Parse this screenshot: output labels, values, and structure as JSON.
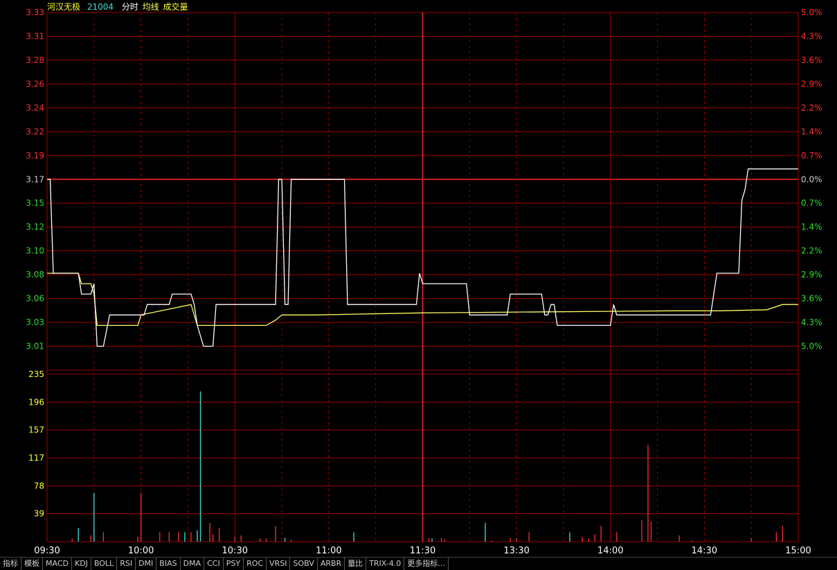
{
  "header": {
    "stock_name": "河汉无极",
    "stock_code": "21004",
    "label_fenshi": "分时",
    "label_junxian": "均线",
    "label_volume": "成交量"
  },
  "price_axis": {
    "labels": [
      "3.33",
      "3.31",
      "3.28",
      "3.26",
      "3.24",
      "3.22",
      "3.19",
      "3.17",
      "3.15",
      "3.12",
      "3.10",
      "3.08",
      "3.06",
      "3.03",
      "3.01"
    ],
    "label_colors": [
      "#ff3030",
      "#ff3030",
      "#ff3030",
      "#ff3030",
      "#ff3030",
      "#ff3030",
      "#ff3030",
      "#cccccc",
      "#33dd33",
      "#33dd33",
      "#33dd33",
      "#33dd33",
      "#33dd33",
      "#33dd33",
      "#33dd33"
    ]
  },
  "pct_axis": {
    "labels": [
      "5.0%",
      "4.3%",
      "3.6%",
      "2.9%",
      "2.2%",
      "1.4%",
      "0.7%",
      "0.0%",
      "0.7%",
      "1.4%",
      "2.2%",
      "2.9%",
      "3.6%",
      "4.3%",
      "5.0%"
    ],
    "label_colors": [
      "#ff3030",
      "#ff3030",
      "#ff3030",
      "#ff3030",
      "#ff3030",
      "#ff3030",
      "#ff3030",
      "#cccccc",
      "#33dd33",
      "#33dd33",
      "#33dd33",
      "#33dd33",
      "#33dd33",
      "#33dd33",
      "#33dd33"
    ]
  },
  "volume_axis": {
    "labels": [
      "235",
      "196",
      "157",
      "117",
      "78",
      "39"
    ]
  },
  "time_axis": {
    "labels": [
      "09:30",
      "10:00",
      "10:30",
      "11:00",
      "11:30",
      "13:30",
      "14:00",
      "14:30",
      "15:00"
    ]
  },
  "colors": {
    "grid": "#a00000",
    "price_line": "#ffffff",
    "avg_line": "#ffff66",
    "vol_up": "#ff3030",
    "vol_down": "#40e0e0",
    "volume_label": "#ffff33"
  },
  "chart_data": {
    "type": "line",
    "prev_close": 3.17,
    "x_range_minutes": [
      0,
      240
    ],
    "price": [
      [
        0,
        3.17
      ],
      [
        1,
        3.17
      ],
      [
        2,
        3.08
      ],
      [
        10,
        3.08
      ],
      [
        11,
        3.06
      ],
      [
        14,
        3.06
      ],
      [
        15,
        3.07
      ],
      [
        16,
        3.01
      ],
      [
        18,
        3.01
      ],
      [
        20,
        3.04
      ],
      [
        31,
        3.04
      ],
      [
        32,
        3.05
      ],
      [
        39,
        3.05
      ],
      [
        40,
        3.06
      ],
      [
        46,
        3.06
      ],
      [
        47,
        3.05
      ],
      [
        48,
        3.03
      ],
      [
        50,
        3.01
      ],
      [
        53,
        3.01
      ],
      [
        54,
        3.05
      ],
      [
        73,
        3.05
      ],
      [
        74,
        3.17
      ],
      [
        75,
        3.17
      ],
      [
        76,
        3.05
      ],
      [
        77,
        3.05
      ],
      [
        78,
        3.17
      ],
      [
        95,
        3.17
      ],
      [
        96,
        3.05
      ],
      [
        118,
        3.05
      ],
      [
        119,
        3.08
      ],
      [
        120,
        3.07
      ],
      [
        134,
        3.07
      ],
      [
        135,
        3.04
      ],
      [
        140,
        3.04
      ],
      [
        141,
        3.04
      ],
      [
        147,
        3.04
      ],
      [
        148,
        3.06
      ],
      [
        158,
        3.06
      ],
      [
        159,
        3.04
      ],
      [
        160,
        3.04
      ],
      [
        161,
        3.05
      ],
      [
        162,
        3.05
      ],
      [
        163,
        3.03
      ],
      [
        180,
        3.03
      ],
      [
        181,
        3.05
      ],
      [
        182,
        3.04
      ],
      [
        212,
        3.04
      ],
      [
        214,
        3.08
      ],
      [
        221,
        3.08
      ],
      [
        222,
        3.15
      ],
      [
        223,
        3.16
      ],
      [
        224,
        3.18
      ],
      [
        230,
        3.18
      ],
      [
        240,
        3.18
      ]
    ],
    "avg_price": [
      [
        0,
        3.08
      ],
      [
        10,
        3.08
      ],
      [
        11,
        3.07
      ],
      [
        14,
        3.07
      ],
      [
        15,
        3.06
      ],
      [
        16,
        3.03
      ],
      [
        29,
        3.03
      ],
      [
        30,
        3.04
      ],
      [
        46,
        3.05
      ],
      [
        47,
        3.04
      ],
      [
        48,
        3.03
      ],
      [
        51,
        3.03
      ],
      [
        52,
        3.03
      ],
      [
        70,
        3.03
      ],
      [
        73,
        3.035
      ],
      [
        75,
        3.04
      ],
      [
        85,
        3.04
      ],
      [
        120,
        3.042
      ],
      [
        160,
        3.043
      ],
      [
        200,
        3.044
      ],
      [
        215,
        3.044
      ],
      [
        230,
        3.045
      ],
      [
        235,
        3.05
      ],
      [
        240,
        3.05
      ]
    ],
    "volume": [
      [
        8,
        5,
        "up"
      ],
      [
        10,
        22,
        "down"
      ],
      [
        14,
        10,
        "up"
      ],
      [
        15,
        78,
        "down"
      ],
      [
        18,
        15,
        "up"
      ],
      [
        29,
        8,
        "up"
      ],
      [
        30,
        78,
        "up"
      ],
      [
        36,
        15,
        "up"
      ],
      [
        39,
        15,
        "up"
      ],
      [
        42,
        15,
        "up"
      ],
      [
        44,
        15,
        "down"
      ],
      [
        46,
        15,
        "up"
      ],
      [
        48,
        18,
        "down"
      ],
      [
        49,
        240,
        "down"
      ],
      [
        52,
        30,
        "up"
      ],
      [
        53,
        12,
        "up"
      ],
      [
        55,
        22,
        "up"
      ],
      [
        60,
        8,
        "up"
      ],
      [
        62,
        10,
        "up"
      ],
      [
        68,
        5,
        "up"
      ],
      [
        70,
        5,
        "up"
      ],
      [
        73,
        25,
        "up"
      ],
      [
        76,
        6,
        "down"
      ],
      [
        78,
        3,
        "up"
      ],
      [
        98,
        15,
        "down"
      ],
      [
        122,
        6,
        "up"
      ],
      [
        123,
        5,
        "down"
      ],
      [
        126,
        6,
        "up"
      ],
      [
        127,
        4,
        "up"
      ],
      [
        140,
        30,
        "down"
      ],
      [
        142,
        2,
        "up"
      ],
      [
        148,
        6,
        "up"
      ],
      [
        150,
        6,
        "up"
      ],
      [
        154,
        15,
        "up"
      ],
      [
        167,
        15,
        "down"
      ],
      [
        171,
        8,
        "up"
      ],
      [
        173,
        5,
        "up"
      ],
      [
        175,
        12,
        "up"
      ],
      [
        177,
        25,
        "up"
      ],
      [
        182,
        15,
        "up"
      ],
      [
        190,
        35,
        "up"
      ],
      [
        192,
        155,
        "up"
      ],
      [
        193,
        32,
        "up"
      ],
      [
        202,
        10,
        "up"
      ],
      [
        206,
        2,
        "up"
      ],
      [
        225,
        6,
        "up"
      ],
      [
        233,
        15,
        "up"
      ],
      [
        235,
        25,
        "up"
      ]
    ],
    "volume_range": [
      0,
      274
    ],
    "price_range": [
      3.01,
      3.33
    ]
  }
}
